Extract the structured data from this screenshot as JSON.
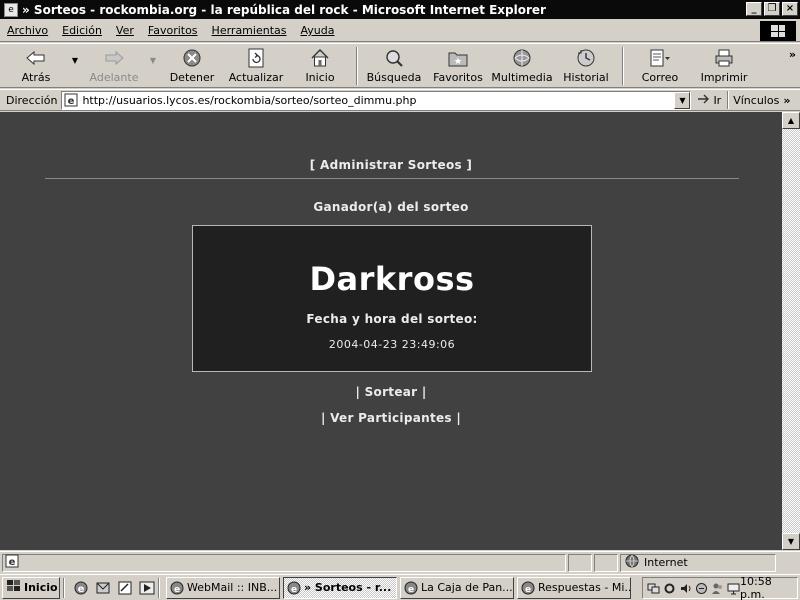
{
  "window": {
    "title": "» Sorteos - rockombia.org - la república del rock - Microsoft Internet Explorer",
    "controls": [
      "_",
      "❐",
      "×"
    ]
  },
  "menu": [
    "Archivo",
    "Edición",
    "Ver",
    "Favoritos",
    "Herramientas",
    "Ayuda"
  ],
  "toolbar": {
    "back": "Atrás",
    "forward": "Adelante",
    "stop": "Detener",
    "refresh": "Actualizar",
    "home": "Inicio",
    "search": "Búsqueda",
    "favorites": "Favoritos",
    "media": "Multimedia",
    "history": "Historial",
    "mail": "Correo",
    "print": "Imprimir",
    "more": "»"
  },
  "address": {
    "label": "Dirección",
    "url": "http://usuarios.lycos.es/rockombia/sorteo/sorteo_dimmu.php",
    "go": "Ir",
    "links": "Vínculos",
    "links_more": "»"
  },
  "page": {
    "admin_link": "[ Administrar Sorteos ]",
    "winner_heading": "Ganador(a) del sorteo",
    "winner_name": "Darkross",
    "draw_label": "Fecha y hora del sorteo:",
    "draw_time": "2004-04-23 23:49:06",
    "sortear": "| Sortear |",
    "ver_participantes": "| Ver Participantes |"
  },
  "status": {
    "zone": "Internet"
  },
  "taskbar": {
    "start": "Inicio",
    "tasks": [
      {
        "label": "WebMail :: INB...",
        "active": false
      },
      {
        "label": "» Sorteos - r...",
        "active": true
      },
      {
        "label": "La Caja de Pan...",
        "active": false
      },
      {
        "label": "Respuestas - Mi...",
        "active": false
      }
    ],
    "clock": "10:58 p.m."
  },
  "icons": {
    "ie": "ie-icon",
    "back": "back-arrow-icon",
    "forward": "forward-arrow-icon",
    "stop": "stop-icon",
    "refresh": "refresh-icon",
    "home": "home-icon",
    "search": "search-icon",
    "favorites": "favorites-folder-icon",
    "media": "media-icon",
    "history": "history-icon",
    "mail": "mail-icon",
    "print": "printer-icon"
  }
}
